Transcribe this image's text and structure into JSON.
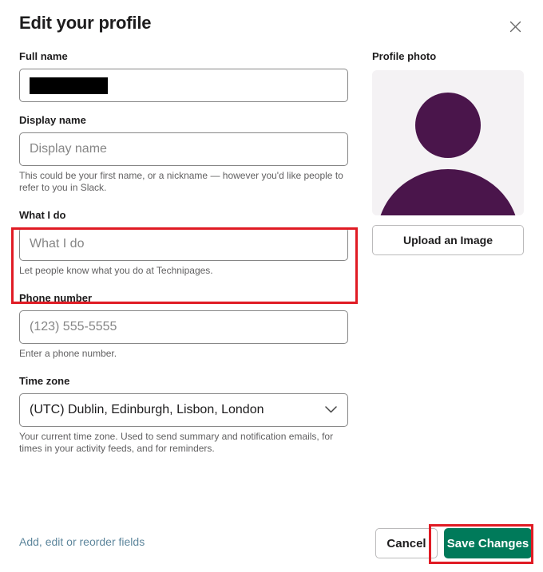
{
  "dialog": {
    "title": "Edit your profile",
    "close_icon": "close-icon"
  },
  "fields": {
    "full_name": {
      "label": "Full name",
      "value": "",
      "placeholder": "",
      "redacted": true
    },
    "display_name": {
      "label": "Display name",
      "value": "",
      "placeholder": "Display name",
      "hint": "This could be your first name, or a nickname — however you'd like people to refer to you in Slack."
    },
    "what_i_do": {
      "label": "What I do",
      "value": "",
      "placeholder": "What I do",
      "hint": "Let people know what you do at Technipages.",
      "highlighted": true
    },
    "phone_number": {
      "label": "Phone number",
      "value": "",
      "placeholder": "(123) 555-5555",
      "hint": "Enter a phone number."
    },
    "time_zone": {
      "label": "Time zone",
      "selected": "(UTC) Dublin, Edinburgh, Lisbon, London",
      "hint": "Your current time zone. Used to send summary and notification emails, for times in your activity feeds, and for reminders.",
      "chevron_icon": "chevron-down-icon"
    }
  },
  "photo": {
    "label": "Profile photo",
    "avatar_icon": "person-avatar-icon",
    "upload_label": "Upload an Image"
  },
  "footer": {
    "fields_link": "Add, edit or reorder fields",
    "cancel_label": "Cancel",
    "save_label": "Save Changes"
  },
  "colors": {
    "accent_green": "#007a5a",
    "avatar_purple": "#4a154b",
    "highlight_red": "#e01b24",
    "link_blue": "#5d869c",
    "text_primary": "#1d1c1d",
    "text_muted": "#616061",
    "border_grey": "#868686"
  }
}
